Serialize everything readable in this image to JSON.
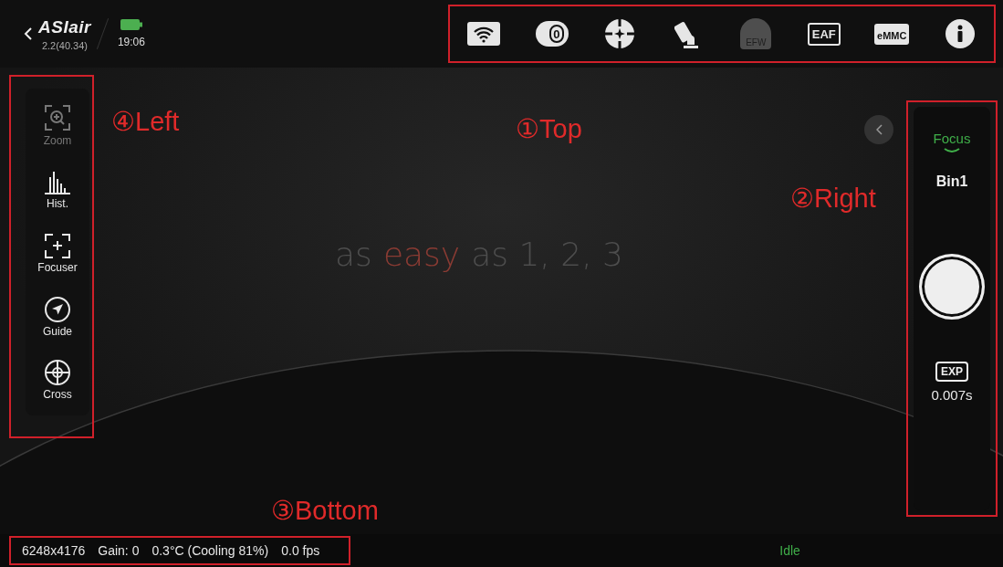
{
  "header": {
    "app_name": "ASIair",
    "version": "2.2(40.34)",
    "time": "19:06"
  },
  "top_toolbar": {
    "annotation": "①Top",
    "items": [
      {
        "kind": "wifi",
        "disabled": false
      },
      {
        "kind": "camera",
        "label": "0",
        "disabled": false
      },
      {
        "kind": "guide",
        "disabled": false
      },
      {
        "kind": "mount",
        "disabled": false
      },
      {
        "kind": "efw",
        "label": "EFW",
        "disabled": true
      },
      {
        "kind": "eaf",
        "label": "EAF",
        "disabled": false
      },
      {
        "kind": "emmc",
        "label": "eMMC",
        "disabled": false
      },
      {
        "kind": "info",
        "disabled": false
      }
    ]
  },
  "left_toolbar": {
    "annotation": "④Left",
    "items": [
      {
        "kind": "zoom",
        "label": "Zoom",
        "disabled": true
      },
      {
        "kind": "hist",
        "label": "Hist.",
        "disabled": false
      },
      {
        "kind": "focuser",
        "label": "Focuser",
        "disabled": false
      },
      {
        "kind": "guide",
        "label": "Guide",
        "disabled": false
      },
      {
        "kind": "cross",
        "label": "Cross",
        "disabled": false
      }
    ]
  },
  "tagline": [
    {
      "text": "as",
      "highlight": false
    },
    {
      "text": "easy",
      "highlight": true
    },
    {
      "text": "as 1, 2, 3",
      "highlight": false
    }
  ],
  "right_panel": {
    "annotation": "②Right",
    "mode": "Focus",
    "binning": "Bin1",
    "exposure_badge": "EXP",
    "exposure": "0.007s"
  },
  "status_bar": {
    "annotation": "③Bottom",
    "items": [
      "6248x4176",
      "Gain: 0",
      "0.3°C (Cooling 81%)",
      "0.0 fps"
    ],
    "state": "Idle"
  }
}
